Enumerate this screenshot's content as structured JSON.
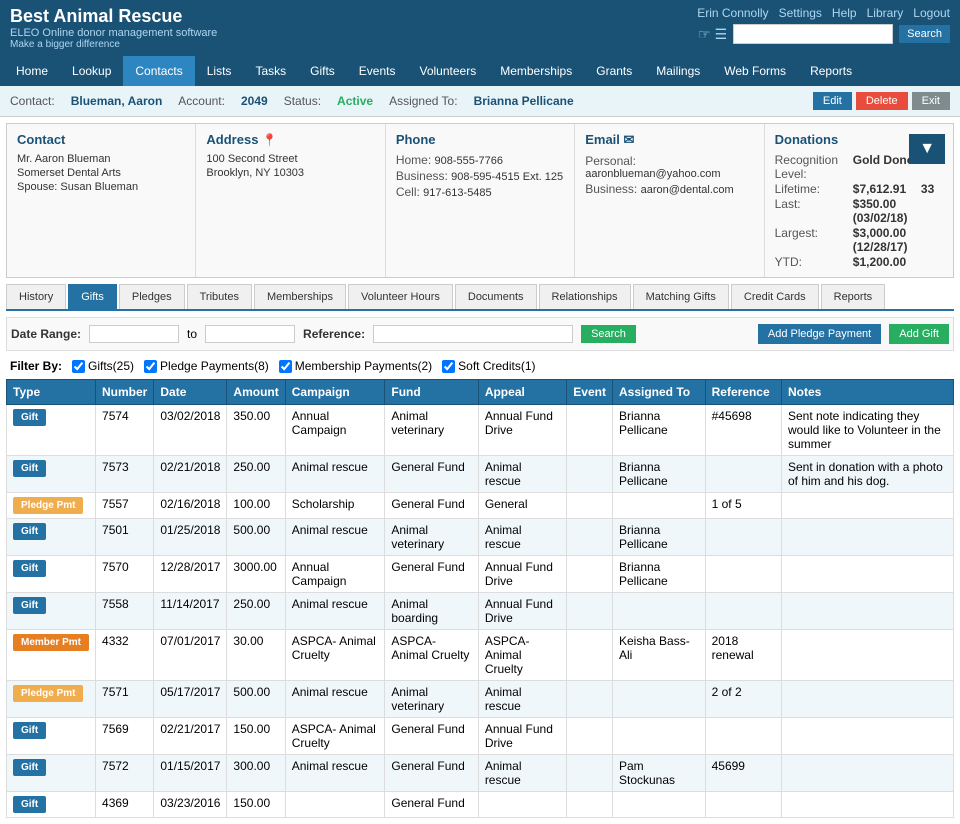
{
  "app": {
    "title": "Best Animal Rescue",
    "subtitle": "ELEO Online donor management software",
    "tagline": "Make a bigger difference"
  },
  "top_nav": {
    "user": "Erin Connolly",
    "links": [
      "Settings",
      "Help",
      "Library",
      "Logout"
    ],
    "search_placeholder": ""
  },
  "main_nav": {
    "items": [
      "Home",
      "Lookup",
      "Contacts",
      "Lists",
      "Tasks",
      "Gifts",
      "Events",
      "Volunteers",
      "Memberships",
      "Grants",
      "Mailings",
      "Web Forms",
      "Reports"
    ]
  },
  "contact_bar": {
    "contact_label": "Contact:",
    "contact_name": "Blueman, Aaron",
    "account_label": "Account:",
    "account_number": "2049",
    "status_label": "Status:",
    "status_value": "Active",
    "assigned_label": "Assigned To:",
    "assigned_name": "Brianna Pellicane",
    "btn_edit": "Edit",
    "btn_delete": "Delete",
    "btn_exit": "Exit"
  },
  "info_panels": {
    "contact": {
      "title": "Contact",
      "lines": [
        "Mr. Aaron Blueman",
        "Somerset Dental Arts",
        "Spouse: Susan Blueman"
      ]
    },
    "address": {
      "title": "Address",
      "lines": [
        "100 Second Street",
        "Brooklyn, NY 10303"
      ]
    },
    "phone": {
      "title": "Phone",
      "home_label": "Home:",
      "home": "908-555-7766",
      "business_label": "Business:",
      "business": "908-595-4515 Ext. 125",
      "cell_label": "Cell:",
      "cell": "917-613-5485"
    },
    "email": {
      "title": "Email",
      "personal_label": "Personal:",
      "personal": "aaronblueman@yahoo.com",
      "business_label": "Business:",
      "business": "aaron@dental.com"
    },
    "donations": {
      "title": "Donations",
      "recognition_label": "Recognition Level:",
      "recognition": "Gold Donor",
      "lifetime_label": "Lifetime:",
      "lifetime": "$7,612.91",
      "lifetime_count": "33",
      "last_label": "Last:",
      "last": "$350.00 (03/02/18)",
      "largest_label": "Largest:",
      "largest": "$3,000.00 (12/28/17)",
      "ytd_label": "YTD:",
      "ytd": "$1,200.00"
    }
  },
  "tabs": [
    "History",
    "Gifts",
    "Pledges",
    "Tributes",
    "Memberships",
    "Volunteer Hours",
    "Documents",
    "Relationships",
    "Matching Gifts",
    "Credit Cards",
    "Reports"
  ],
  "active_tab": "Gifts",
  "gifts_section": {
    "date_range_label": "Date Range:",
    "to_label": "to",
    "reference_label": "Reference:",
    "search_btn": "Search",
    "add_pledge_btn": "Add Pledge Payment",
    "add_gift_btn": "Add Gift",
    "filter_by_label": "Filter By:",
    "filters": [
      {
        "label": "Gifts(25)",
        "checked": true
      },
      {
        "label": "Pledge Payments(8)",
        "checked": true
      },
      {
        "label": "Membership Payments(2)",
        "checked": true
      },
      {
        "label": "Soft Credits(1)",
        "checked": true
      }
    ],
    "table_headers": [
      "Type",
      "Number",
      "Date",
      "Amount",
      "Campaign",
      "Fund",
      "Appeal",
      "Event",
      "Assigned To",
      "Reference",
      "Notes"
    ],
    "rows": [
      {
        "type": "Gift",
        "type_class": "type-gift",
        "number": "7574",
        "date": "03/02/2018",
        "amount": "350.00",
        "campaign": "Annual Campaign",
        "fund": "Animal veterinary",
        "appeal": "Annual Fund Drive",
        "event": "",
        "assigned_to": "Brianna Pellicane",
        "reference": "#45698",
        "notes": "Sent note indicating they would like to Volunteer in the summer"
      },
      {
        "type": "Gift",
        "type_class": "type-gift",
        "number": "7573",
        "date": "02/21/2018",
        "amount": "250.00",
        "campaign": "Animal rescue",
        "fund": "General Fund",
        "appeal": "Animal rescue",
        "event": "",
        "assigned_to": "Brianna Pellicane",
        "reference": "",
        "notes": "Sent in donation with a photo of him and his dog."
      },
      {
        "type": "Pledge Pmt",
        "type_class": "type-pledge",
        "number": "7557",
        "date": "02/16/2018",
        "amount": "100.00",
        "campaign": "Scholarship",
        "fund": "General Fund",
        "appeal": "General",
        "event": "",
        "assigned_to": "",
        "reference": "1 of 5",
        "notes": ""
      },
      {
        "type": "Gift",
        "type_class": "type-gift",
        "number": "7501",
        "date": "01/25/2018",
        "amount": "500.00",
        "campaign": "Animal rescue",
        "fund": "Animal veterinary",
        "appeal": "Animal rescue",
        "event": "",
        "assigned_to": "Brianna Pellicane",
        "reference": "",
        "notes": ""
      },
      {
        "type": "Gift",
        "type_class": "type-gift",
        "number": "7570",
        "date": "12/28/2017",
        "amount": "3000.00",
        "campaign": "Annual Campaign",
        "fund": "General Fund",
        "appeal": "Annual Fund Drive",
        "event": "",
        "assigned_to": "Brianna Pellicane",
        "reference": "",
        "notes": ""
      },
      {
        "type": "Gift",
        "type_class": "type-gift",
        "number": "7558",
        "date": "11/14/2017",
        "amount": "250.00",
        "campaign": "Animal rescue",
        "fund": "Animal boarding",
        "appeal": "Annual Fund Drive",
        "event": "",
        "assigned_to": "",
        "reference": "",
        "notes": ""
      },
      {
        "type": "Member Pmt",
        "type_class": "type-member",
        "number": "4332",
        "date": "07/01/2017",
        "amount": "30.00",
        "campaign": "ASPCA- Animal Cruelty",
        "fund": "ASPCA- Animal Cruelty",
        "appeal": "ASPCA- Animal Cruelty",
        "event": "",
        "assigned_to": "Keisha Bass-Ali",
        "reference": "2018 renewal",
        "notes": ""
      },
      {
        "type": "Pledge Pmt",
        "type_class": "type-pledge",
        "number": "7571",
        "date": "05/17/2017",
        "amount": "500.00",
        "campaign": "Animal rescue",
        "fund": "Animal veterinary",
        "appeal": "Animal rescue",
        "event": "",
        "assigned_to": "",
        "reference": "2 of 2",
        "notes": ""
      },
      {
        "type": "Gift",
        "type_class": "type-gift",
        "number": "7569",
        "date": "02/21/2017",
        "amount": "150.00",
        "campaign": "ASPCA- Animal Cruelty",
        "fund": "General Fund",
        "appeal": "Annual Fund Drive",
        "event": "",
        "assigned_to": "",
        "reference": "",
        "notes": ""
      },
      {
        "type": "Gift",
        "type_class": "type-gift",
        "number": "7572",
        "date": "01/15/2017",
        "amount": "300.00",
        "campaign": "Animal rescue",
        "fund": "General Fund",
        "appeal": "Animal rescue",
        "event": "",
        "assigned_to": "Pam Stockunas",
        "reference": "45699",
        "notes": ""
      },
      {
        "type": "Gift",
        "type_class": "type-gift",
        "number": "4369",
        "date": "03/23/2016",
        "amount": "150.00",
        "campaign": "",
        "fund": "General Fund",
        "appeal": "",
        "event": "",
        "assigned_to": "",
        "reference": "",
        "notes": ""
      }
    ]
  }
}
